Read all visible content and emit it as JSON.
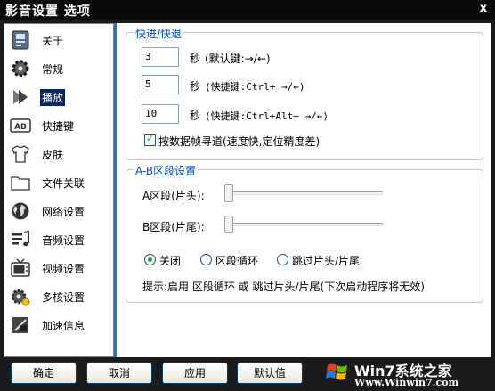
{
  "window": {
    "title": "影音设置 选项",
    "close_label": "x"
  },
  "sidebar": {
    "items": [
      {
        "label": "关于",
        "icon": "info-icon"
      },
      {
        "label": "常规",
        "icon": "gear-icon"
      },
      {
        "label": "播放",
        "icon": "play-icon",
        "selected": true
      },
      {
        "label": "快捷键",
        "icon": "keyboard-ab-icon"
      },
      {
        "label": "皮肤",
        "icon": "tshirt-icon"
      },
      {
        "label": "文件关联",
        "icon": "folder-icon"
      },
      {
        "label": "网络设置",
        "icon": "globe-icon"
      },
      {
        "label": "音频设置",
        "icon": "audio-icon"
      },
      {
        "label": "视频设置",
        "icon": "tv-icon"
      },
      {
        "label": "多核设置",
        "icon": "cpu-gear-icon"
      },
      {
        "label": "加速信息",
        "icon": "accelerate-icon"
      }
    ]
  },
  "seek": {
    "legend": "快进/快退",
    "rows": [
      {
        "value": "3",
        "unit": "秒",
        "hint": "(默认键:→/←)"
      },
      {
        "value": "5",
        "unit": "秒",
        "hint": "(快捷键:Ctrl+ →/←)"
      },
      {
        "value": "10",
        "unit": "秒",
        "hint": "(快捷键:Ctrl+Alt+ →/←)"
      }
    ],
    "checkbox_label": "按数据帧寻道(速度快,定位精度差)",
    "checkbox_checked": true
  },
  "ab": {
    "legend": "A-B区段设置",
    "a_label": "A区段(片头):",
    "b_label": "B区段(片尾):",
    "a_value": 0,
    "b_value": 0,
    "radios": [
      {
        "label": "关闭",
        "checked": true
      },
      {
        "label": "区段循环",
        "checked": false
      },
      {
        "label": "跳过片头/片尾",
        "checked": false
      }
    ],
    "tip": "提示:启用 区段循环 或 跳过片头/片尾(下次启动程序将无效)"
  },
  "buttons": {
    "ok": "确定",
    "cancel": "取消",
    "apply": "应用",
    "default": "默认值"
  },
  "watermark": {
    "brand": "Win7系统之家",
    "url": "Www.Winwin7.com"
  },
  "colors": {
    "accent": "#0046d5",
    "selected_bg": "#0a246a",
    "check_green": "#21a121"
  }
}
